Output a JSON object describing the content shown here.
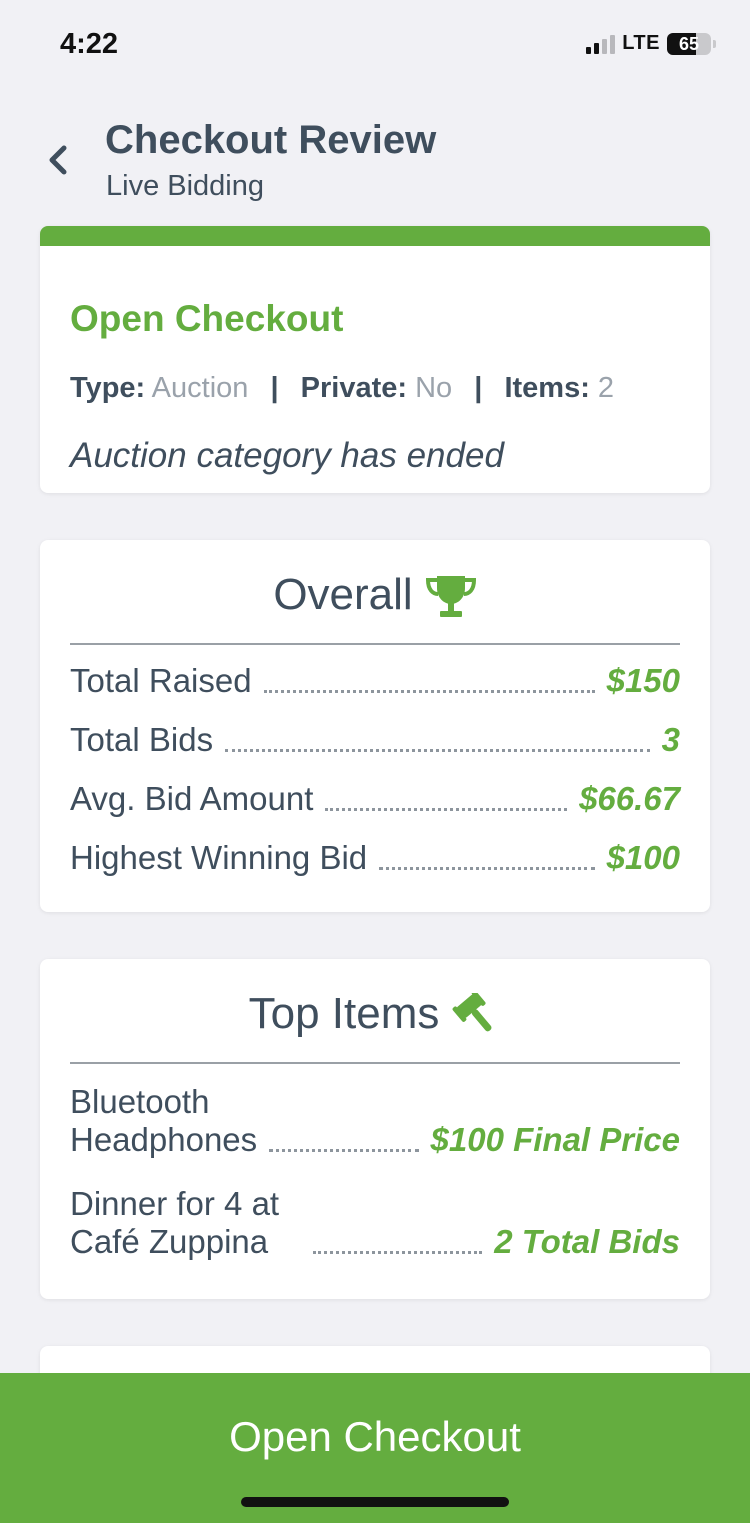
{
  "status_bar": {
    "time": "4:22",
    "network": "LTE",
    "battery_level": "65"
  },
  "header": {
    "title": "Checkout Review",
    "subtitle": "Live Bidding"
  },
  "status_card": {
    "title": "Open Checkout",
    "type_label": "Type:",
    "type_value": "Auction",
    "private_label": "Private:",
    "private_value": "No",
    "items_label": "Items:",
    "items_value": "2",
    "separator": "|",
    "note": "Auction category has ended",
    "accent_color": "#64ad3f"
  },
  "overall": {
    "heading": "Overall",
    "icon": "trophy-icon",
    "rows": [
      {
        "label": "Total Raised",
        "value": "$150"
      },
      {
        "label": "Total Bids",
        "value": "3"
      },
      {
        "label": "Avg. Bid Amount",
        "value": "$66.67"
      },
      {
        "label": "Highest Winning Bid",
        "value": "$100"
      }
    ]
  },
  "top_items": {
    "heading": "Top Items",
    "icon": "gavel-icon",
    "rows": [
      {
        "label_line1": "Bluetooth",
        "label_line2": "Headphones",
        "value": "$100 Final Price"
      },
      {
        "label_line1": "Dinner for 4 at",
        "label_line2": "Café Zuppina",
        "value": "2 Total Bids"
      }
    ]
  },
  "footer": {
    "button_label": "Open Checkout",
    "color": "#64ad3f"
  }
}
